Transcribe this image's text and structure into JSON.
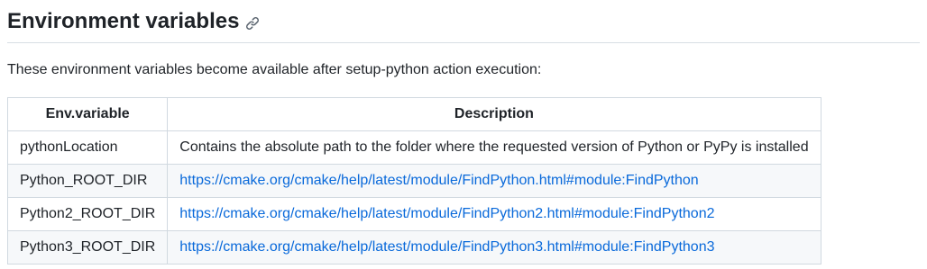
{
  "heading": {
    "title": "Environment variables",
    "anchor_icon": "link-icon"
  },
  "intro": "These environment variables become available after setup-python action execution:",
  "table": {
    "headers": [
      "Env.variable",
      "Description"
    ],
    "rows": [
      {
        "env": "pythonLocation",
        "description": "Contains the absolute path to the folder where the requested version of Python or PyPy is installed",
        "is_link": false
      },
      {
        "env": "Python_ROOT_DIR",
        "description": "https://cmake.org/cmake/help/latest/module/FindPython.html#module:FindPython",
        "is_link": true
      },
      {
        "env": "Python2_ROOT_DIR",
        "description": "https://cmake.org/cmake/help/latest/module/FindPython2.html#module:FindPython2",
        "is_link": true
      },
      {
        "env": "Python3_ROOT_DIR",
        "description": "https://cmake.org/cmake/help/latest/module/FindPython3.html#module:FindPython3",
        "is_link": true
      }
    ]
  },
  "colors": {
    "text": "#1f2328",
    "link": "#0969da",
    "border": "#d1d9e0",
    "row_alt": "#f6f8fa"
  }
}
